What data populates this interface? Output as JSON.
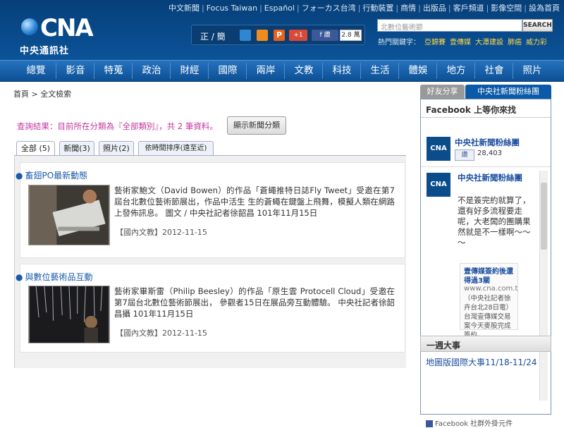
{
  "toplinks": [
    "中文新聞",
    "Focus Taiwan",
    "Español",
    "フォーカス台湾",
    "行動裝置",
    "商情",
    "出版品",
    "客戶頻道",
    "影像空間",
    "設為首頁"
  ],
  "logo": {
    "brand": "CNA",
    "name": "中央通訊社"
  },
  "toolbar": {
    "lang": "正 / 簡",
    "plus": "+1",
    "fb": "f 讚",
    "count": "2.8 萬"
  },
  "search": {
    "placeholder": "北數位藝術節",
    "button": "SEARCH"
  },
  "hotkeys": {
    "label": "熱門關鍵字：",
    "items": [
      "亞錦賽",
      "壹傳媒",
      "大潭建設",
      "肺癌",
      "威力彩"
    ]
  },
  "nav": [
    "總覽",
    "影音",
    "特蒐",
    "政治",
    "財經",
    "國際",
    "兩岸",
    "文教",
    "科技",
    "生活",
    "體娛",
    "地方",
    "社會",
    "照片"
  ],
  "breadcrumb": "首頁 > 全文檢索",
  "result": {
    "text": "查詢結果：目前所在分類為『全部類別』，共 2 筆資料。",
    "button": "顯示新聞分類"
  },
  "tabs": [
    "全部 (5)",
    "新聞(3)",
    "照片(2)",
    "依時間排序(遠至近)"
  ],
  "entries": [
    {
      "title": "畜翅PO最新動態",
      "text": "藝術家鮑文（David Bowen）的作品「蒼蠅推特日誌Fly Tweet」受邀在第7屆台北數位藝術節展出，作品中活生 生的蒼蠅在鍵盤上飛舞，模擬人類在網路上發佈訊息。 圖文 / 中央社記者徐韶昌 101年11月15日",
      "meta": "【國內文教】2012-11-15"
    },
    {
      "title": "與數位藝術品互動",
      "text": "藝術家畢斯雷（Philip Beesley）的作品「原生雲 Protocell Cloud」受邀在第7屆台北數位藝術節展出， 參觀者15日在展品旁互動體驗。 中央社記者徐韶昌攝 101年11月15日",
      "meta": "【國內文教】2012-11-15"
    }
  ],
  "sidebar": {
    "tab1": "好友分享",
    "tab2": "中央社新聞粉絲團",
    "fbhead": "Facebook 上等你來找",
    "pagename": "中央社新聞粉絲團",
    "logo_text": "CNA",
    "like": "讚",
    "likes": "28,403",
    "post_name": "中央社新聞粉絲團",
    "post_text": "不是簽完約就算了，還有好多流程要走呢，大老闆的團購果然就是不一樣啊～～～",
    "card_title": "壹傳媒簽約後還得過3關",
    "card_url": "www.cna.com.t",
    "card_desc": "（中央社記者徐卉台北28日電）台灣壹傳媒交易案今天麥股完成簽約，",
    "plugin": "Facebook 社群外掛元件",
    "week_head": "一週大事",
    "week_item": "地圖版國際大事11/18-11/24"
  }
}
